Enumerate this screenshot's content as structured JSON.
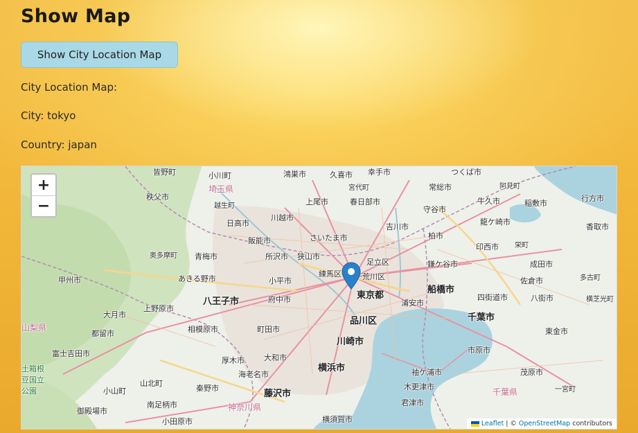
{
  "page": {
    "title": "Show Map",
    "button_label": "Show City Location Map",
    "map_heading": "City Location Map:",
    "city_line": "City: tokyo",
    "country_line": "Country: japan"
  },
  "map": {
    "zoom_in": "+",
    "zoom_out": "−",
    "marker_icon": "map-pin-icon",
    "marker_color": "#2a81cb",
    "attribution": {
      "leaflet": "Leaflet",
      "separator": "| ©",
      "osm": "OpenStreetMap",
      "contributors": "contributors"
    },
    "labels": {
      "minano": "皆野町",
      "ogawa": "小川町",
      "saitama_pref": "埼玉県",
      "konosu": "鴻巣市",
      "kuki": "久喜市",
      "satte": "幸手市",
      "miyashiro": "宮代町",
      "tsukuba": "つくば市",
      "joso": "常総市",
      "ami": "阿見町",
      "chichibu": "秩父市",
      "ogose": "越生町",
      "ageo": "上尾市",
      "kasukabe": "春日部市",
      "moriya": "守谷市",
      "ushiku": "牛久市",
      "inashiki": "稲敷市",
      "namegata": "行方市",
      "hidaka": "日高市",
      "kawagoe": "川越市",
      "yoshikawa": "吉川市",
      "ryugasaki": "龍ケ崎市",
      "katori": "香取市",
      "hanno": "飯能市",
      "saitama": "さいたま市",
      "kashiwa": "柏市",
      "sayama": "狭山市",
      "okutama": "奥多摩町",
      "ome": "青梅市",
      "tokorozawa": "所沢市",
      "asaka": "朝霞市",
      "adachi": "足立区",
      "inzai": "印西市",
      "sakae": "栄町",
      "kamagaya": "鎌ケ谷市",
      "narita": "成田市",
      "nerima": "練馬区",
      "arakawa": "荒川区",
      "tako": "多古町",
      "kofu": "甲州市",
      "akiruno": "あきる野市",
      "kodaira": "小平市",
      "funabashi": "船橋市",
      "sakura": "佐倉市",
      "tokyo": "東京都",
      "urayasu": "浦安市",
      "yotsukaido": "四街道市",
      "yachimata": "八街市",
      "yokoshiba": "横芝光町",
      "hachioji": "八王子市",
      "fuchu": "府中市",
      "uenohara": "上野原市",
      "otsuki": "大月市",
      "shinagawa": "品川区",
      "chiba": "千葉市",
      "yamanashi_pref": "山梨県",
      "tsuru": "都留市",
      "sagamihara": "相模原市",
      "machida": "町田市",
      "togane": "東金市",
      "kawasaki": "川崎市",
      "fujiyoshida": "富士吉田市",
      "ichihara": "市原市",
      "atsugi": "厚木市",
      "yamato": "大和市",
      "hakone_green": "土箱根",
      "park_green": "豆国立",
      "park2_green": "公園",
      "yokohama": "横浜市",
      "ebina": "海老名市",
      "kisarazu": "木更津市",
      "sodegaura": "袖ケ浦市",
      "mobara": "茂原市",
      "oyama": "小山町",
      "yamakita": "山北町",
      "hadano": "秦野市",
      "fujisawa": "藤沢市",
      "kimitsu": "君津市",
      "chiba_pref": "千葉県",
      "ichinomiya": "一宮町",
      "gotemba": "御殿場市",
      "minamiashigara": "南足柄市",
      "kanagawa_pref": "神奈川県",
      "odawara": "小田原市",
      "yokosuka": "横須賀市"
    }
  }
}
